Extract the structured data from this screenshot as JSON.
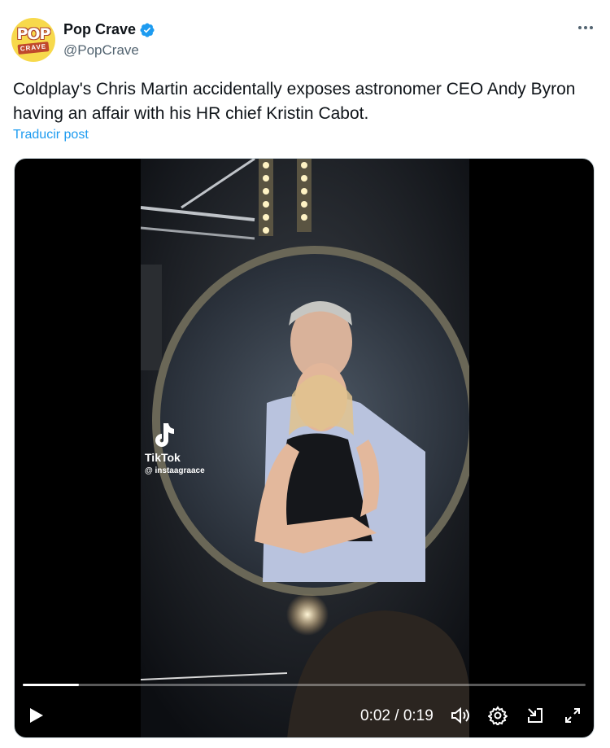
{
  "author": {
    "display_name": "Pop Crave",
    "handle": "@PopCrave",
    "avatar_text_top": "POP",
    "avatar_text_bottom": "CRAVE"
  },
  "post": {
    "text": "Coldplay's Chris Martin accidentally exposes astronomer CEO Andy Byron having an affair with his HR chief Kristin Cabot.",
    "translate_label": "Traducir post"
  },
  "video": {
    "watermark_brand": "TikTok",
    "watermark_user": "@ instaagraace",
    "time_display": "0:02 / 0:19",
    "progress_fraction": 0.1
  },
  "icons": [
    "verified-badge-icon",
    "more-options-icon",
    "play-icon",
    "volume-icon",
    "settings-icon",
    "pip-icon",
    "fullscreen-icon",
    "tiktok-logo-icon"
  ],
  "colors": {
    "link": "#1d9bf0",
    "verified": "#1d9bf0",
    "secondary_text": "#536471"
  }
}
